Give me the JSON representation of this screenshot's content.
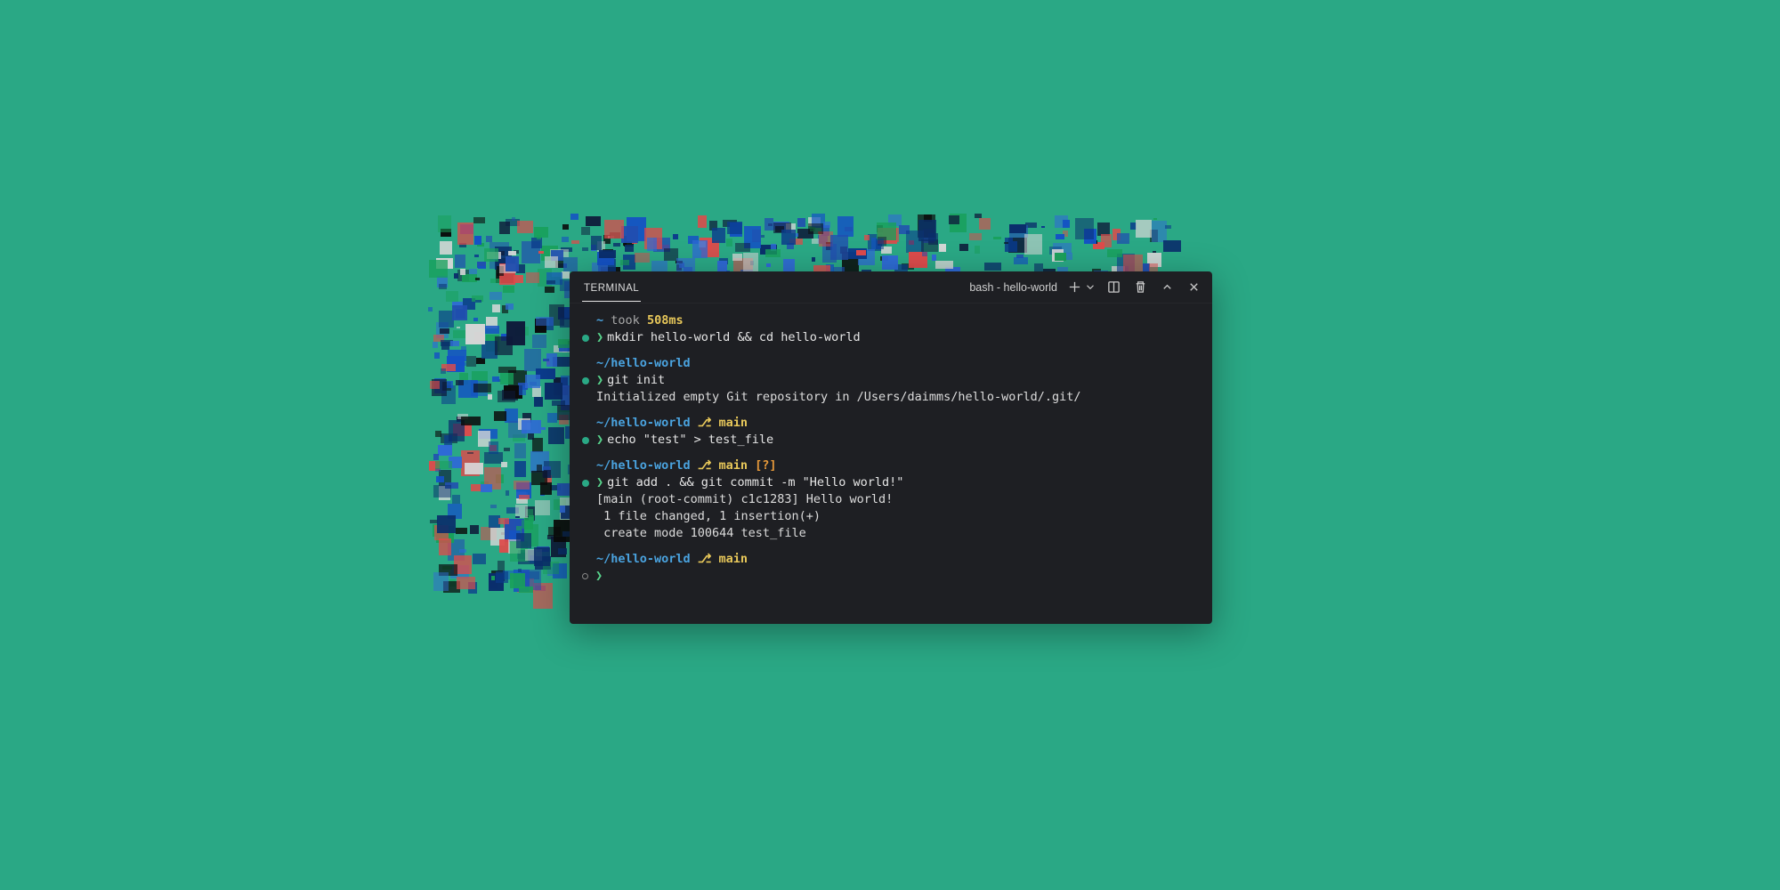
{
  "header": {
    "tab": "TERMINAL",
    "shell": "bash - hello-world"
  },
  "blocks": [
    {
      "prompt": {
        "path": "~",
        "took": "took",
        "time": "508ms",
        "branch": null,
        "status": null
      },
      "cmd": "mkdir hello-world && cd hello-world",
      "output": []
    },
    {
      "prompt": {
        "path": "~/hello-world",
        "took": null,
        "time": null,
        "branch": null,
        "status": null
      },
      "cmd": "git init",
      "output": [
        "Initialized empty Git repository in /Users/daimms/hello-world/.git/"
      ]
    },
    {
      "prompt": {
        "path": "~/hello-world",
        "took": null,
        "time": null,
        "branch": "main",
        "status": null
      },
      "cmd": "echo \"test\" > test_file",
      "output": []
    },
    {
      "prompt": {
        "path": "~/hello-world",
        "took": null,
        "time": null,
        "branch": "main",
        "status": "[?]"
      },
      "cmd": "git add . && git commit -m \"Hello world!\"",
      "output": [
        "[main (root-commit) c1c1283] Hello world!",
        " 1 file changed, 1 insertion(+)",
        " create mode 100644 test_file"
      ]
    },
    {
      "prompt": {
        "path": "~/hello-world",
        "took": null,
        "time": null,
        "branch": "main",
        "status": null
      },
      "cmd": "",
      "output": [],
      "idle": true
    }
  ],
  "branch_glyph": "⎇"
}
